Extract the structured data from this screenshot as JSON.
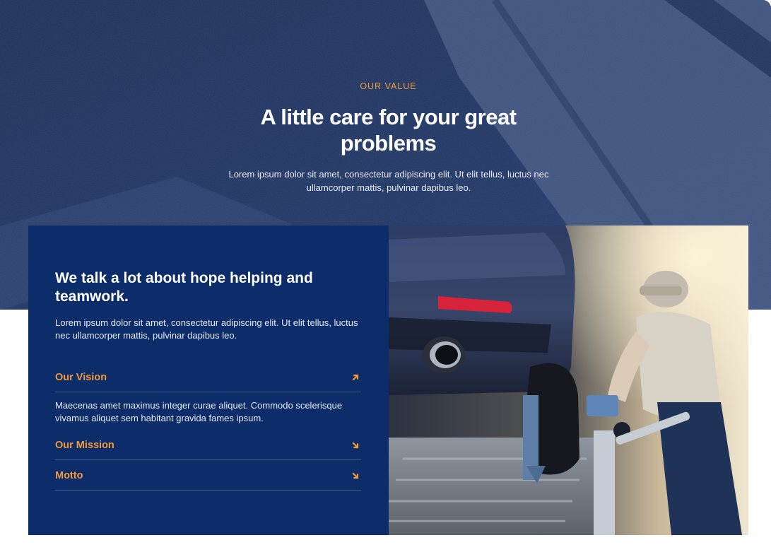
{
  "hero": {
    "eyebrow": "OUR VALUE",
    "title": "A little care for your great problems",
    "description": "Lorem ipsum dolor sit amet, consectetur adipiscing elit. Ut elit tellus, luctus nec ullamcorper mattis, pulvinar dapibus leo."
  },
  "panel": {
    "heading": "We talk a lot about hope helping and teamwork.",
    "description": "Lorem ipsum dolor sit amet, consectetur adipiscing elit. Ut elit tellus, luctus nec ullamcorper mattis, pulvinar dapibus leo.",
    "accordion": [
      {
        "title": "Our Vision",
        "icon": "arrow-up-right-icon",
        "expanded": true,
        "body": "Maecenas amet maximus integer curae aliquet. Commodo scelerisque vivamus aliquet sem habitant gravida fames ipsum."
      },
      {
        "title": "Our Mission",
        "icon": "arrow-down-right-icon",
        "expanded": false
      },
      {
        "title": "Motto",
        "icon": "arrow-down-right-icon",
        "expanded": false
      }
    ]
  },
  "colors": {
    "accent": "#f29a3b",
    "panel": "#0c2d69",
    "hero": "#23375e"
  },
  "image": {
    "subject": "mechanic securing car on tow truck"
  }
}
